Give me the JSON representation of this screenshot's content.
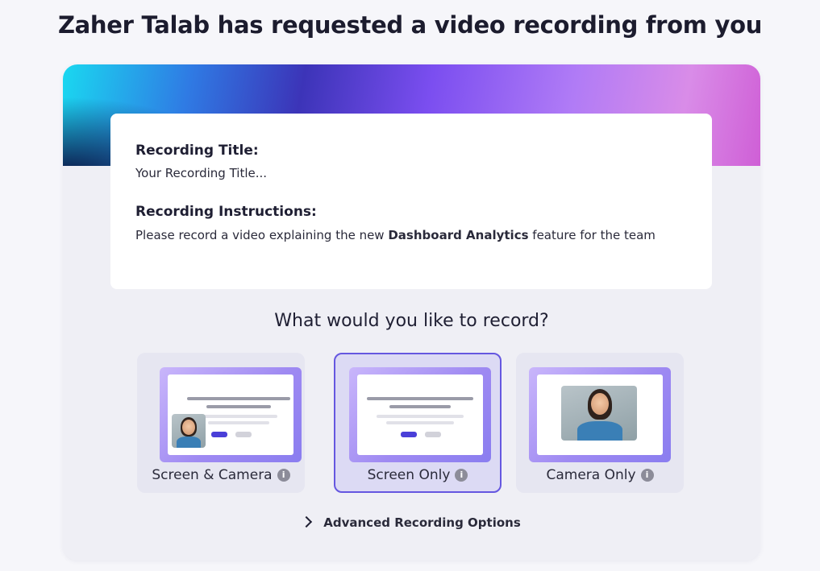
{
  "page": {
    "title": "Zaher Talab has requested a video recording from you"
  },
  "info": {
    "title_label": "Recording Title:",
    "title_value": "Your Recording Title...",
    "instructions_label": "Recording Instructions:",
    "instructions_before": "Please record a video explaining the new ",
    "instructions_bold": "Dashboard Analytics",
    "instructions_after": " feature for the team"
  },
  "question": "What would you like to record?",
  "options": [
    {
      "label": "Screen & Camera",
      "selected": false,
      "icon": "info-icon"
    },
    {
      "label": "Screen Only",
      "selected": true,
      "icon": "info-icon"
    },
    {
      "label": "Camera Only",
      "selected": false,
      "icon": "info-icon"
    }
  ],
  "info_icon_glyph": "i",
  "advanced": {
    "label": "Advanced Recording Options",
    "icon": "chevron-right-icon"
  },
  "colors": {
    "accent": "#6557e0",
    "button": "#4a3fd8"
  }
}
